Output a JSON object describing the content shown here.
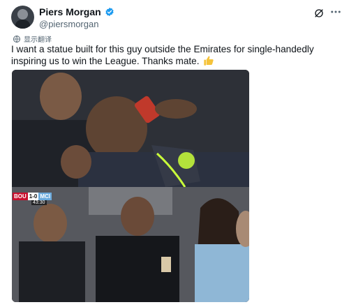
{
  "author": {
    "display_name": "Piers Morgan",
    "handle": "@piersmorgan",
    "verified": true
  },
  "translate_label": "显示翻译",
  "tweet_text": "I want a statue built for this guy outside the Emirates for single-handedly inspiring us to win the League. Thanks mate.",
  "colors": {
    "verified": "#1d9bf0",
    "text": "#0f1419",
    "secondary": "#536471"
  },
  "icons": {
    "verified": "verified-badge-icon",
    "grok": "grok-icon",
    "more": "more-options-icon",
    "translate": "translate-icon",
    "thumbs_up": "thumbs-up-emoji"
  },
  "scoreboard": {
    "home_team": "BOU",
    "score": "1-0",
    "away_team": "MCI",
    "clock": "43:30"
  }
}
